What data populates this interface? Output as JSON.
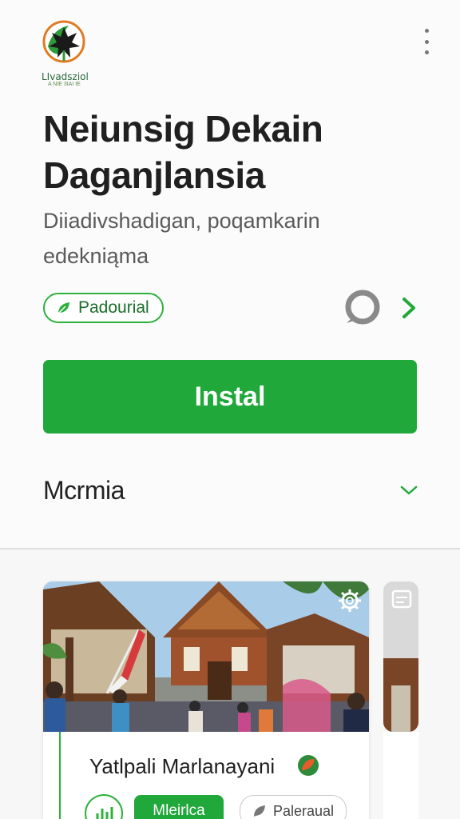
{
  "header": {
    "logo_text": "LIvadsziol",
    "logo_subtext": "A NIE 3IAI IE",
    "menu_icon": "more-vertical-icon"
  },
  "app": {
    "title_line1": "Neiunsig Dekain",
    "title_line2": "Daganjlansia",
    "subtitle_line1": "Diiadivshadigan, poqamkarin",
    "subtitle_line2": "edekniąma",
    "chip_label": "Padourial",
    "install_label": "Instal"
  },
  "section": {
    "title": "Mcrmia"
  },
  "cards": [
    {
      "title": "Yatlpali Marlanayani",
      "tag_primary": "Mleirlca",
      "tag_secondary": "Paleraual"
    }
  ],
  "colors": {
    "accent_green": "#21a83a",
    "chip_text": "#1c6e2b",
    "background": "#fbfbfb"
  }
}
